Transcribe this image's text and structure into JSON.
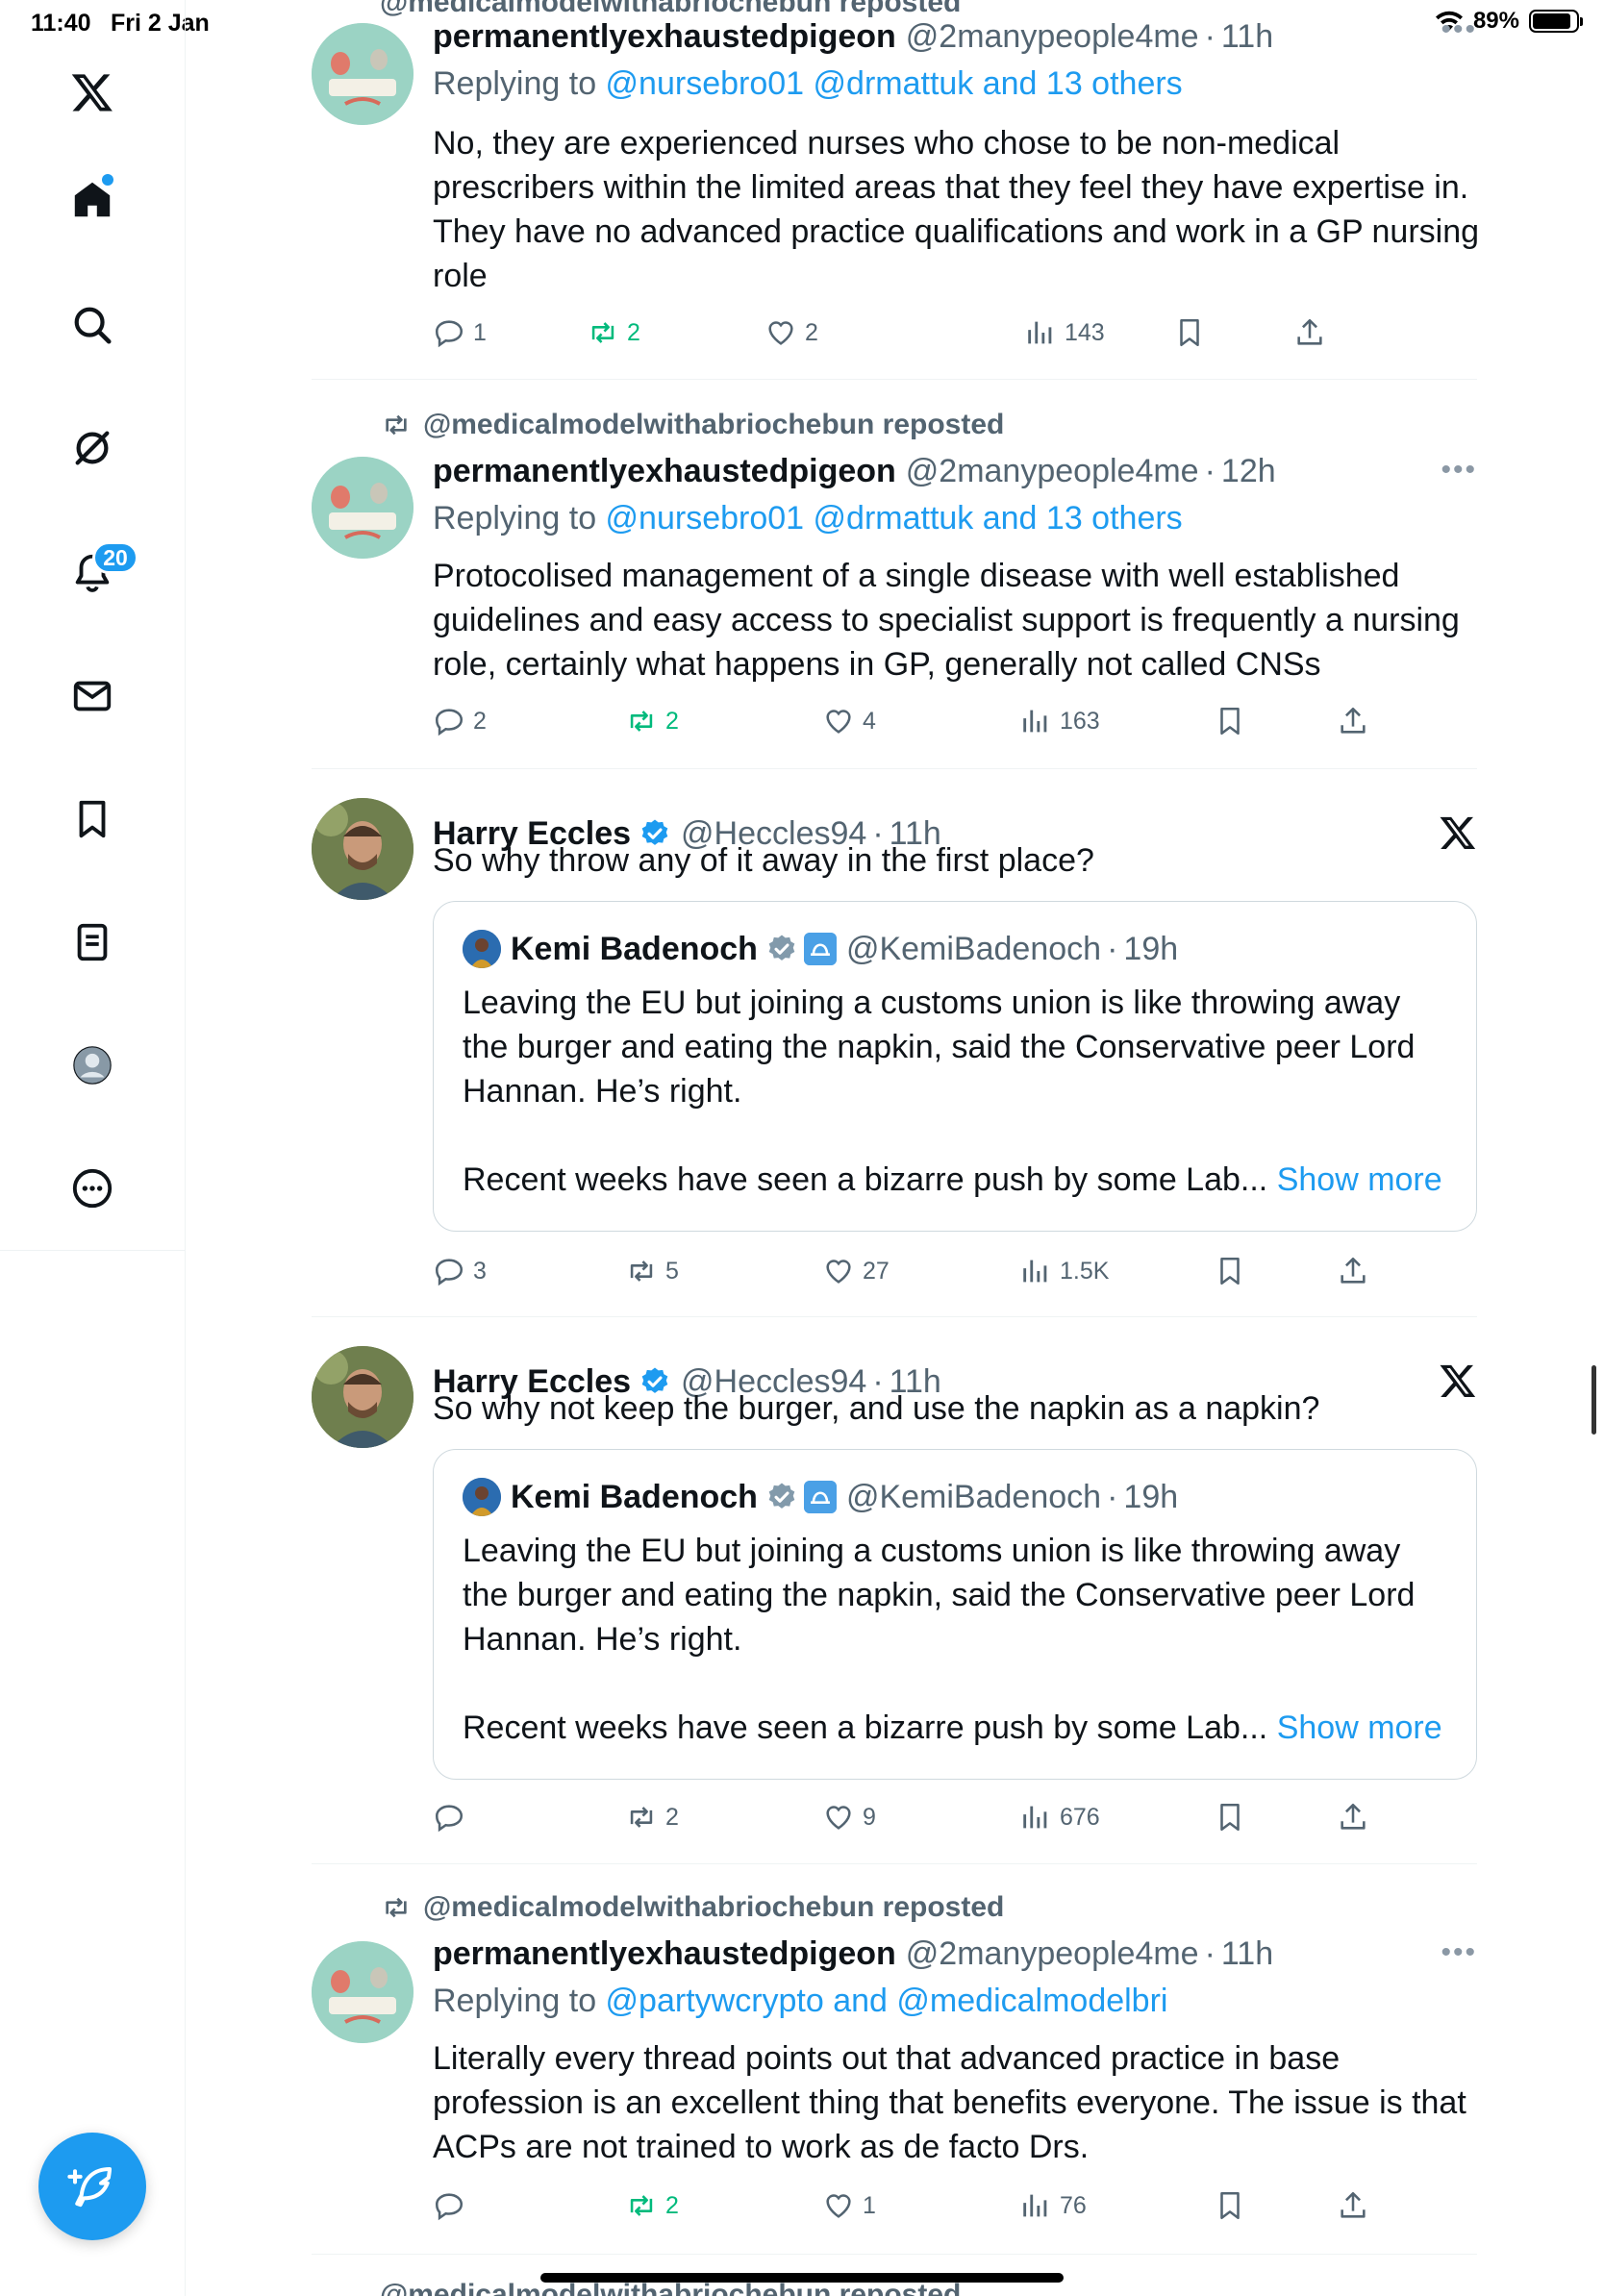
{
  "status_bar": {
    "time": "11:40",
    "date": "Fri 2 Jan",
    "battery": "89%",
    "battery_level": 0.89
  },
  "sidebar": {
    "notifications_count": "20"
  },
  "top_partial": "@medicalmodelwithabriochebun reposted",
  "bottom_partial": "@medicalmodelwithabriochebun reposted",
  "tweets": [
    {
      "repost_by": "",
      "name": "permanentlyexhaustedpigeon",
      "handle": "@2manypeople4me",
      "time": "11h",
      "reply_prefix": "Replying to ",
      "reply_targets": "@nursebro01 @drmattuk and 13 others",
      "text": "No, they are experienced nurses who chose to be non-medical prescribers within the limited areas that they feel they have expertise in. They have no advanced practice qualifications and work in a GP nursing role",
      "replies": "1",
      "reposts": "2",
      "likes": "2",
      "views": "143"
    },
    {
      "repost_by": "@medicalmodelwithabriochebun reposted",
      "name": "permanentlyexhaustedpigeon",
      "handle": "@2manypeople4me",
      "time": "12h",
      "reply_prefix": "Replying to ",
      "reply_targets": "@nursebro01 @drmattuk and 13 others",
      "text": "Protocolised management of a single disease with well established guidelines and easy access to specialist support is frequently a nursing role, certainly what happens in GP, generally not called CNSs",
      "replies": "2",
      "reposts": "2",
      "likes": "4",
      "views": "163"
    },
    {
      "name": "Harry Eccles",
      "handle": "@Heccles94",
      "time": "11h",
      "text": "So why throw any of it away in the first place?",
      "quote": {
        "name": "Kemi Badenoch",
        "handle": "@KemiBadenoch",
        "time": "19h",
        "text": "Leaving the EU but joining a customs union is like throwing away the burger and eating the napkin, said the Conservative peer Lord Hannan. He’s right.",
        "text2": "Recent weeks have seen a bizarre push by some Lab...",
        "show_more": "Show more"
      },
      "replies": "3",
      "reposts": "5",
      "likes": "27",
      "views": "1.5K"
    },
    {
      "name": "Harry Eccles",
      "handle": "@Heccles94",
      "time": "11h",
      "text": "So why not keep the burger, and use the napkin as a napkin?",
      "quote": {
        "name": "Kemi Badenoch",
        "handle": "@KemiBadenoch",
        "time": "19h",
        "text": "Leaving the EU but joining a customs union is like throwing away the burger and eating the napkin, said the Conservative peer Lord Hannan. He’s right.",
        "text2": "Recent weeks have seen a bizarre push by some Lab...",
        "show_more": "Show more"
      },
      "replies": "",
      "reposts": "2",
      "likes": "9",
      "views": "676"
    },
    {
      "repost_by": "@medicalmodelwithabriochebun reposted",
      "name": "permanentlyexhaustedpigeon",
      "handle": "@2manypeople4me",
      "time": "11h",
      "reply_prefix": "Replying to ",
      "reply_targets": "@partywcrypto and @medicalmodelbri",
      "text": "Literally every thread points out that advanced practice in base profession is an excellent thing that benefits everyone. The issue is that ACPs are not trained to work as de facto Drs.",
      "replies": "",
      "reposts": "2",
      "likes": "1",
      "views": "76"
    }
  ],
  "colors": {
    "accent": "#1d9bf0",
    "repost_green": "#00ba7c",
    "secondary_text": "#536471",
    "border": "#eff3f4"
  }
}
